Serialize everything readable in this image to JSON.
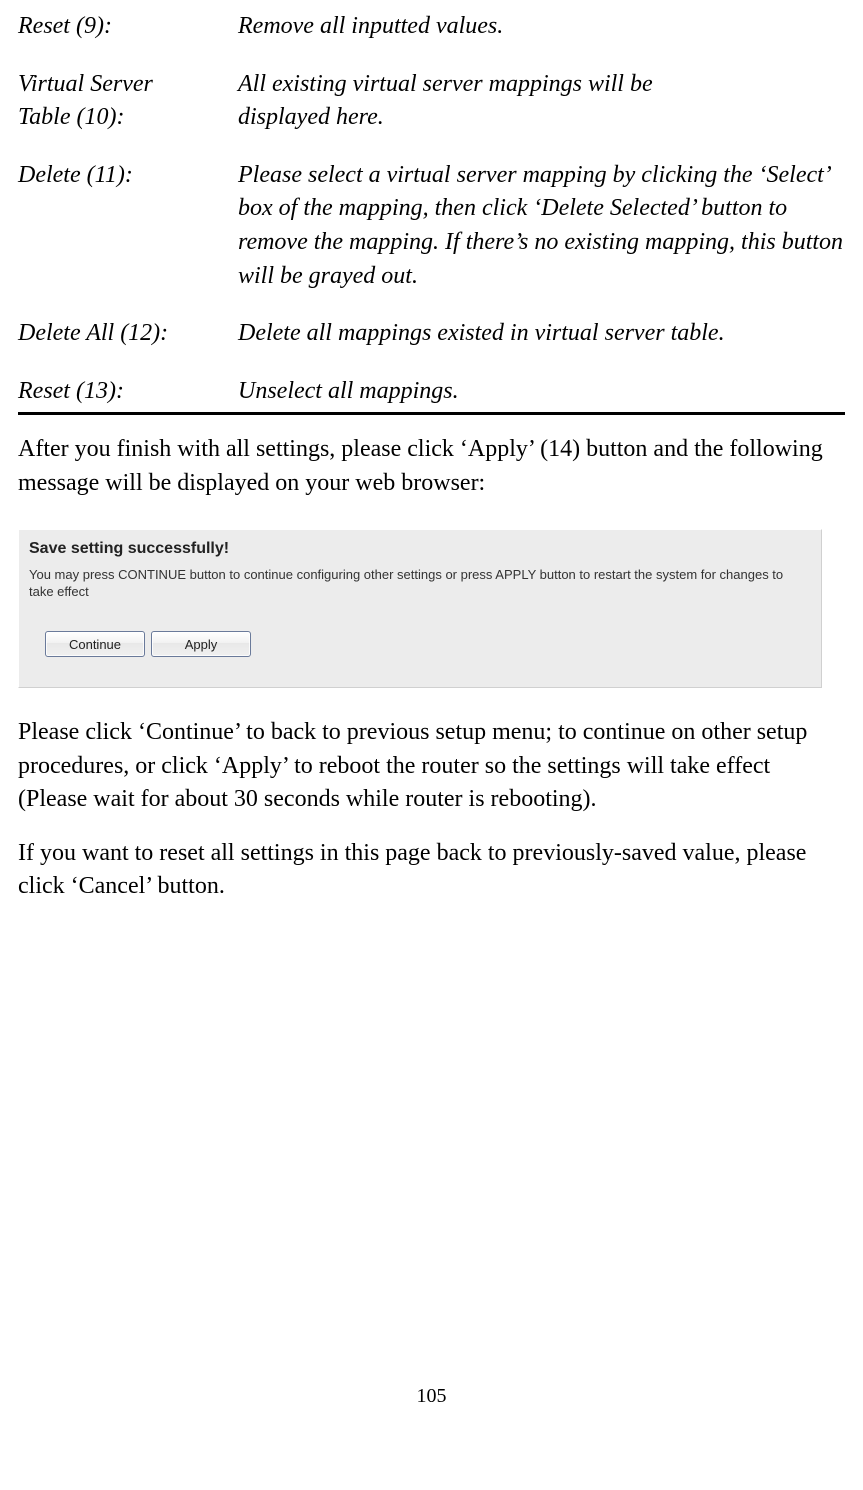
{
  "definitions": [
    {
      "term": "Reset (9):",
      "desc": "Remove all inputted values."
    },
    {
      "term_line1": "Virtual Server",
      "term_line2": "Table (10):",
      "desc_line1": "All existing virtual server mappings will be",
      "desc_line2": "displayed here."
    },
    {
      "term": "Delete (11):",
      "desc": "Please select a virtual server mapping by clicking the ‘Select’ box of the mapping, then click ‘Delete Selected’ button to remove the mapping. If there’s no existing mapping, this button will be grayed out."
    },
    {
      "term": "Delete All (12):",
      "desc": "Delete all mappings existed in virtual server table."
    },
    {
      "term": "Reset (13):",
      "desc": "Unselect all mappings."
    }
  ],
  "para_1": "After you finish with all settings, please click ‘Apply’ (14) button and the following message will be displayed on your web browser:",
  "dialog": {
    "title": "Save setting successfully!",
    "text": "You may press CONTINUE button to continue configuring other settings or press APPLY button to restart the system for changes to take effect",
    "continue_label": "Continue",
    "apply_label": "Apply"
  },
  "para_2": "Please click ‘Continue’ to back to previous setup menu; to continue on other setup procedures, or click ‘Apply’ to reboot the router so the settings will take effect (Please wait for about 30 seconds while router is rebooting).",
  "para_3": "If you want to reset all settings in this page back to previously-saved value, please click ‘Cancel’ button.",
  "page_number": "105"
}
